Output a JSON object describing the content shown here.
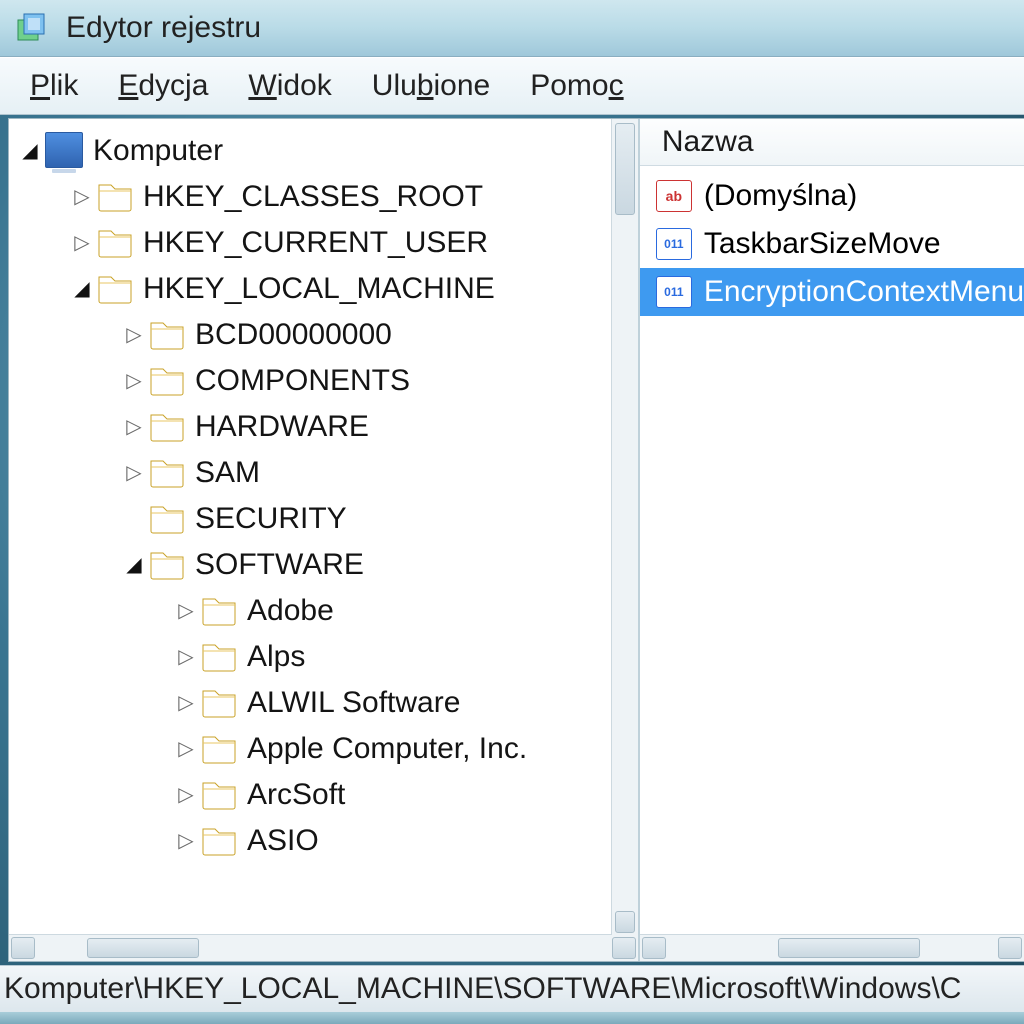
{
  "window": {
    "title": "Edytor rejestru"
  },
  "menubar": {
    "items": [
      {
        "label": "Plik",
        "mn": "P"
      },
      {
        "label": "Edycja",
        "mn": "E"
      },
      {
        "label": "Widok",
        "mn": "W"
      },
      {
        "label": "Ulubione",
        "mn": "b"
      },
      {
        "label": "Pomoc",
        "mn": "c"
      }
    ]
  },
  "tree": {
    "root_label": "Komputer",
    "items": [
      {
        "depth": 0,
        "exp": "expanded",
        "icon": "computer",
        "label": "Komputer"
      },
      {
        "depth": 1,
        "exp": "collapsed",
        "icon": "folder",
        "label": "HKEY_CLASSES_ROOT"
      },
      {
        "depth": 1,
        "exp": "collapsed",
        "icon": "folder",
        "label": "HKEY_CURRENT_USER"
      },
      {
        "depth": 1,
        "exp": "expanded",
        "icon": "folder",
        "label": "HKEY_LOCAL_MACHINE"
      },
      {
        "depth": 2,
        "exp": "collapsed",
        "icon": "folder",
        "label": "BCD00000000"
      },
      {
        "depth": 2,
        "exp": "collapsed",
        "icon": "folder",
        "label": "COMPONENTS"
      },
      {
        "depth": 2,
        "exp": "collapsed",
        "icon": "folder",
        "label": "HARDWARE"
      },
      {
        "depth": 2,
        "exp": "collapsed",
        "icon": "folder",
        "label": "SAM"
      },
      {
        "depth": 2,
        "exp": "none",
        "icon": "folder",
        "label": "SECURITY"
      },
      {
        "depth": 2,
        "exp": "expanded",
        "icon": "folder",
        "label": "SOFTWARE"
      },
      {
        "depth": 3,
        "exp": "collapsed",
        "icon": "folder",
        "label": "Adobe"
      },
      {
        "depth": 3,
        "exp": "collapsed",
        "icon": "folder",
        "label": "Alps"
      },
      {
        "depth": 3,
        "exp": "collapsed",
        "icon": "folder",
        "label": "ALWIL Software"
      },
      {
        "depth": 3,
        "exp": "collapsed",
        "icon": "folder",
        "label": "Apple Computer, Inc."
      },
      {
        "depth": 3,
        "exp": "collapsed",
        "icon": "folder",
        "label": "ArcSoft"
      },
      {
        "depth": 3,
        "exp": "collapsed",
        "icon": "folder",
        "label": "ASIO"
      }
    ]
  },
  "list": {
    "header": "Nazwa",
    "rows": [
      {
        "icon": "sz",
        "label": "(Domyślna)",
        "selected": false
      },
      {
        "icon": "dw",
        "label": "TaskbarSizeMove",
        "selected": false
      },
      {
        "icon": "dw",
        "label": "EncryptionContextMenu",
        "selected": true
      }
    ]
  },
  "statusbar": {
    "path": "Komputer\\HKEY_LOCAL_MACHINE\\SOFTWARE\\Microsoft\\Windows\\C"
  }
}
